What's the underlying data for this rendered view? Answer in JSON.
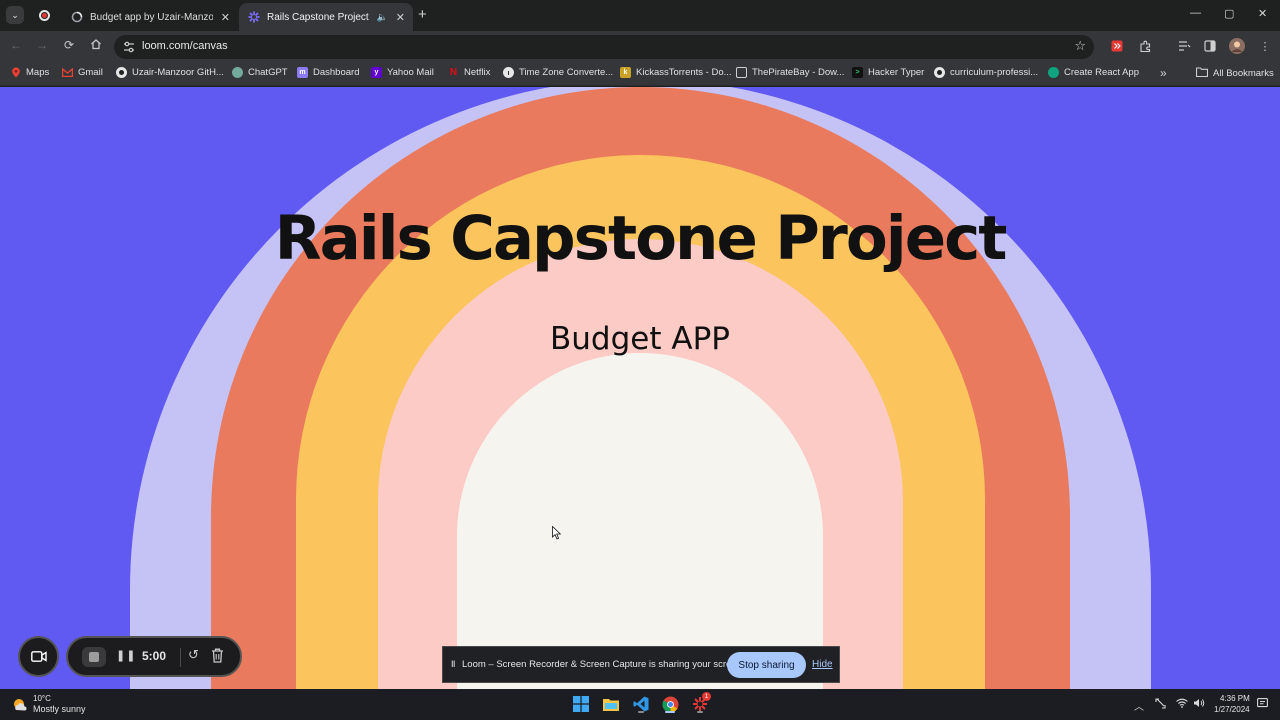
{
  "tabs": [
    {
      "title": "Budget app by Uzair-Manzoor",
      "close": "✕",
      "active": false
    },
    {
      "title": "Rails Capstone Project",
      "close": "✕",
      "active": true
    }
  ],
  "tabstrip": {
    "new_tab": "+",
    "minimize": "—",
    "maximize": "▢",
    "close": "✕"
  },
  "address_bar": {
    "url": "loom.com/canvas"
  },
  "bookmarks": [
    {
      "label": "Maps",
      "color": "#34a853"
    },
    {
      "label": "Gmail",
      "color": "#ea4335"
    },
    {
      "label": "Uzair-Manzoor GitH...",
      "color": "#e6e6e6"
    },
    {
      "label": "ChatGPT",
      "color": "#74aa9c"
    },
    {
      "label": "Dashboard",
      "color": "#8b7cf6"
    },
    {
      "label": "Yahoo Mail",
      "color": "#6001d2"
    },
    {
      "label": "Netflix",
      "color": "#e50914"
    },
    {
      "label": "Time Zone Converte...",
      "color": "#e6e6e6"
    },
    {
      "label": "KickassTorrents - Do...",
      "color": "#c9a227"
    },
    {
      "label": "ThePirateBay - Dow...",
      "color": "#cfcfcf"
    },
    {
      "label": "Hacker Typer",
      "color": "#2e7d32"
    },
    {
      "label": "curriculum-professi...",
      "color": "#e6e6e6"
    },
    {
      "label": "Create React App",
      "color": "#10a37f"
    }
  ],
  "bookmarks_all": "All Bookmarks",
  "page": {
    "title": "Rails Capstone Project",
    "subtitle": "Budget APP",
    "arch_colors": [
      "#c5c2f5",
      "#e97a5d",
      "#fbc45c",
      "#fccbc5",
      "#f5f4ee"
    ],
    "background": "#6059f2"
  },
  "loom": {
    "timer": "5:00",
    "share_message": "Loom – Screen Recorder & Screen Capture is sharing your screen.",
    "stop_sharing": "Stop sharing",
    "hide": "Hide"
  },
  "taskbar": {
    "temperature": "10°C",
    "weather": "Mostly sunny",
    "time": "4:36 PM",
    "date": "1/27/2024",
    "chrome_badge": "1"
  }
}
